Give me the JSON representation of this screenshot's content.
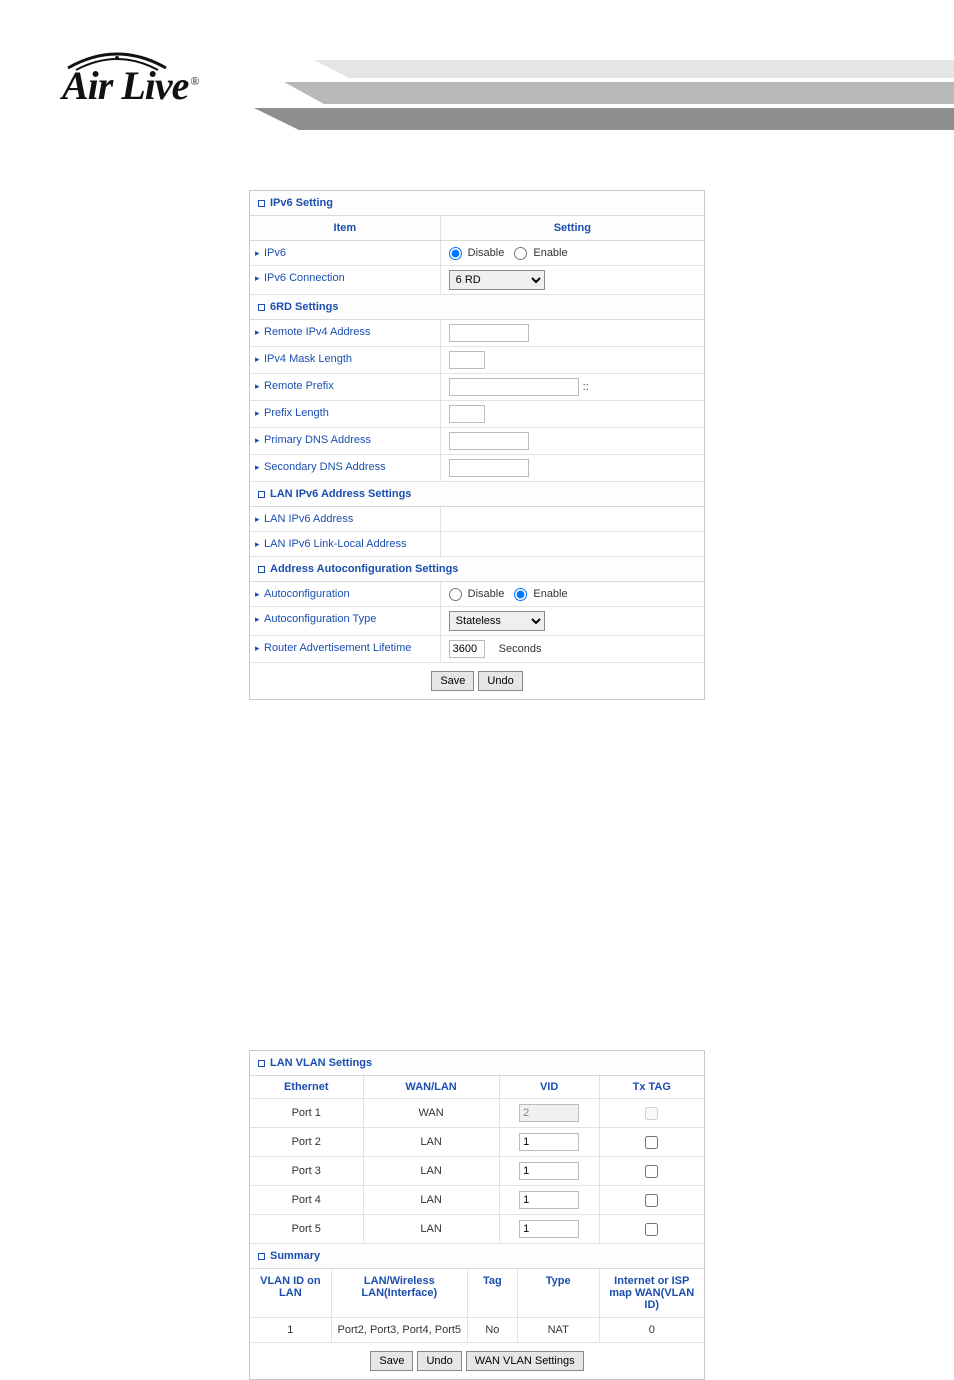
{
  "brand": {
    "name": "Air Live",
    "registered": "®"
  },
  "ipv6": {
    "section_title": "IPv6 Setting",
    "hdr_item": "Item",
    "hdr_setting": "Setting",
    "rows": {
      "ipv6_lbl": "IPv6",
      "ipv6_disable": "Disable",
      "ipv6_enable": "Enable",
      "conn_lbl": "IPv6 Connection",
      "conn_val": "6 RD"
    },
    "sixrd_title": "6RD Settings",
    "sixrd": {
      "remote_ipv4": "Remote IPv4 Address",
      "ipv4_mask_len": "IPv4 Mask Length",
      "remote_prefix": "Remote Prefix",
      "prefix_len": "Prefix Length",
      "primary_dns": "Primary DNS Address",
      "secondary_dns": "Secondary DNS Address"
    },
    "lan_title": "LAN IPv6 Address Settings",
    "lan": {
      "addr": "LAN IPv6 Address",
      "link_local": "LAN IPv6 Link-Local Address"
    },
    "auto_title": "Address Autoconfiguration Settings",
    "auto": {
      "autoconf_lbl": "Autoconfiguration",
      "autoconf_disable": "Disable",
      "autoconf_enable": "Enable",
      "type_lbl": "Autoconfiguration Type",
      "type_val": "Stateless",
      "lifetime_lbl": "Router Advertisement Lifetime",
      "lifetime_val": "3600",
      "lifetime_unit": "Seconds"
    },
    "btn_save": "Save",
    "btn_undo": "Undo"
  },
  "vlan": {
    "section_title": "LAN VLAN Settings",
    "hdr": {
      "ethernet": "Ethernet",
      "wan_lan": "WAN/LAN",
      "vid": "VID",
      "txtag": "Tx TAG"
    },
    "rows": [
      {
        "port": "Port 1",
        "role": "WAN",
        "vid": "2",
        "disabled": true
      },
      {
        "port": "Port 2",
        "role": "LAN",
        "vid": "1",
        "disabled": false
      },
      {
        "port": "Port 3",
        "role": "LAN",
        "vid": "1",
        "disabled": false
      },
      {
        "port": "Port 4",
        "role": "LAN",
        "vid": "1",
        "disabled": false
      },
      {
        "port": "Port 5",
        "role": "LAN",
        "vid": "1",
        "disabled": false
      }
    ],
    "summary_title": "Summary",
    "summary_hdr": {
      "vlan_id": "VLAN ID on LAN",
      "iface": "LAN/Wireless LAN(Interface)",
      "tag": "Tag",
      "type": "Type",
      "map": "Internet or ISP map WAN(VLAN ID)"
    },
    "summary_row": {
      "vlan_id": "1",
      "iface": "Port2, Port3, Port4, Port5",
      "tag": "No",
      "type": "NAT",
      "map": "0"
    },
    "btn_save": "Save",
    "btn_undo": "Undo",
    "btn_wan": "WAN VLAN Settings"
  }
}
